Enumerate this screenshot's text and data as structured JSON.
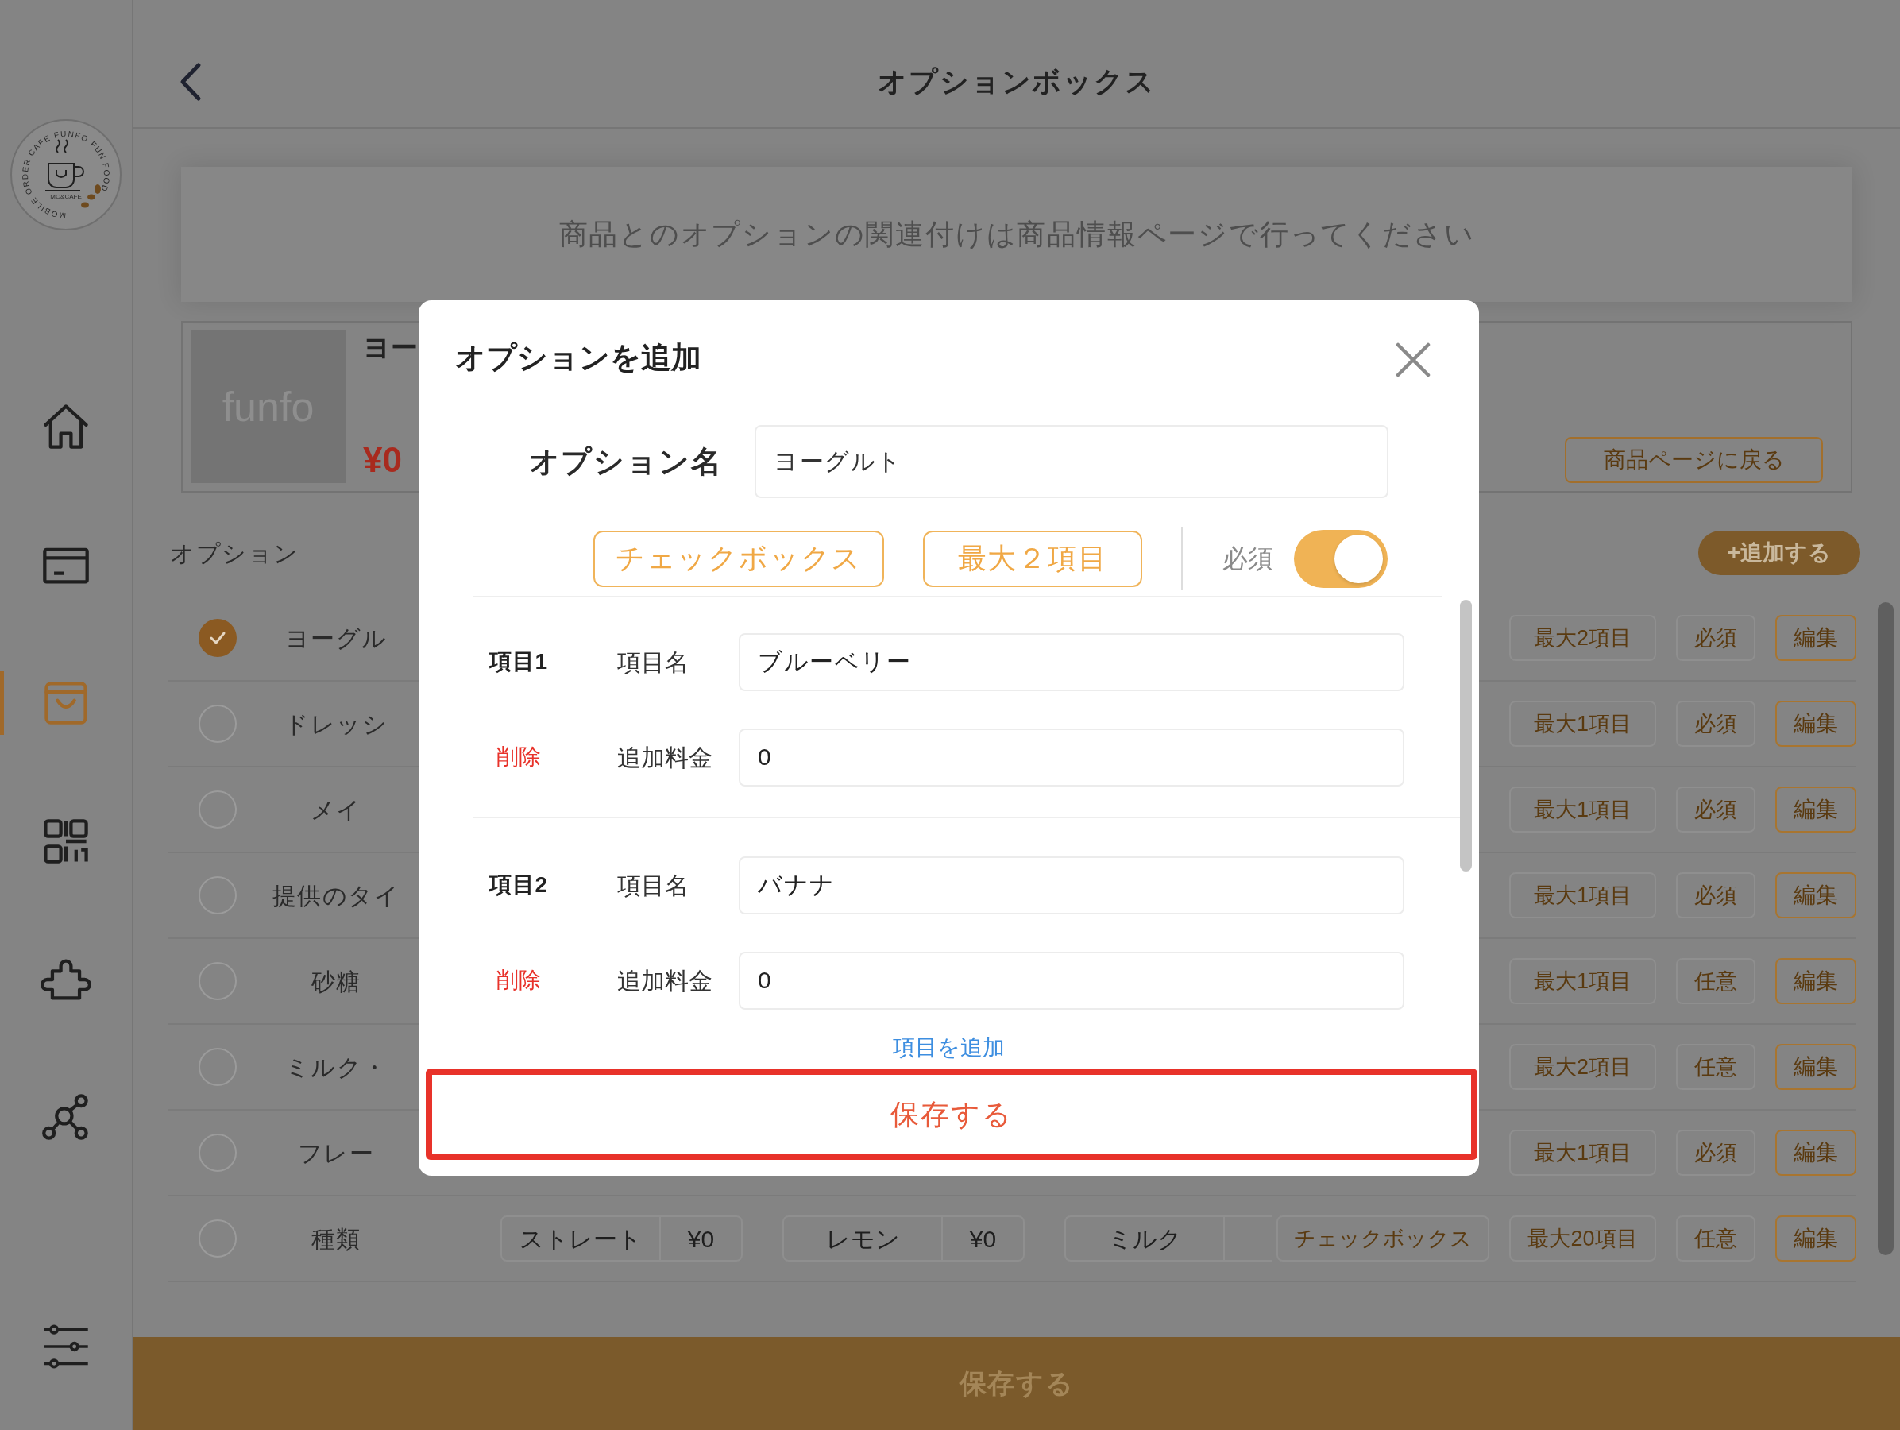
{
  "sidebar": {
    "logo": {
      "ring_text": "MOBILE ORDER CAFE FUNFO FUN FOOD",
      "caption": "MO&CAFE"
    },
    "items": [
      {
        "kind": "home",
        "selected": false
      },
      {
        "kind": "card",
        "selected": false
      },
      {
        "kind": "bag",
        "selected": true
      },
      {
        "kind": "qr",
        "selected": false
      },
      {
        "kind": "puzzle",
        "selected": false
      },
      {
        "kind": "network",
        "selected": false
      }
    ],
    "settings": {
      "kind": "sliders",
      "selected": false
    }
  },
  "header": {
    "title": "オプションボックス"
  },
  "notice": "商品とのオプションの関連付けは商品情報ページで行ってください",
  "product": {
    "image_text": "funfo",
    "name": "ヨー",
    "price": "¥0",
    "back_button": "商品ページに戻る"
  },
  "options": {
    "label": "オプション",
    "add_button": "+追加する",
    "rows": [
      {
        "selected": true,
        "name": "ヨーグル",
        "max": "最大2項目",
        "required": "必須",
        "edit": "編集"
      },
      {
        "selected": false,
        "name": "ドレッシ",
        "max": "最大1項目",
        "required": "必須",
        "edit": "編集"
      },
      {
        "selected": false,
        "name": "メイ",
        "max": "最大1項目",
        "required": "必須",
        "edit": "編集"
      },
      {
        "selected": false,
        "name": "提供のタイ",
        "max": "最大1項目",
        "required": "必須",
        "edit": "編集"
      },
      {
        "selected": false,
        "name": "砂糖",
        "max": "最大1項目",
        "required": "任意",
        "edit": "編集"
      },
      {
        "selected": false,
        "name": "ミルク・",
        "max": "最大2項目",
        "required": "任意",
        "edit": "編集"
      },
      {
        "selected": false,
        "name": "フレー",
        "max": "最大1項目",
        "required": "必須",
        "edit": "編集"
      },
      {
        "selected": false,
        "name": "種類",
        "choices": [
          {
            "name": "ストレート",
            "price": "¥0"
          },
          {
            "name": "レモン",
            "price": "¥0"
          },
          {
            "name": "ミルク"
          }
        ],
        "type": "チェックボックス",
        "max": "最大20項目",
        "required": "任意",
        "edit": "編集"
      }
    ]
  },
  "bottom_bar": {
    "save_button": "保存する"
  },
  "modal": {
    "title": "オプションを追加",
    "name_label": "オプション名",
    "name_value": "ヨーグルト",
    "type_button": "チェックボックス",
    "max_button": "最大２項目",
    "required_label": "必須",
    "required_on": true,
    "items": [
      {
        "label": "項目1",
        "name_label": "項目名",
        "name_value": "ブルーベリー",
        "delete": "削除",
        "price_label": "追加料金",
        "price_value": "0"
      },
      {
        "label": "項目2",
        "name_label": "項目名",
        "name_value": "バナナ",
        "delete": "削除",
        "price_label": "追加料金",
        "price_value": "0"
      }
    ],
    "add_item": "項目を追加",
    "save_button": "保存する"
  }
}
